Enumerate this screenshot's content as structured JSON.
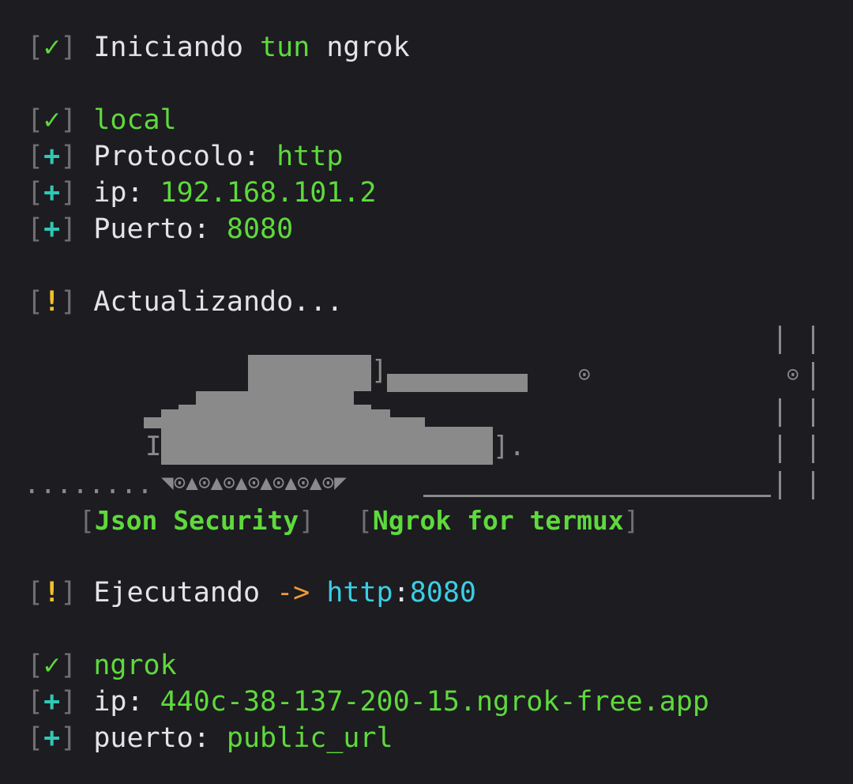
{
  "symbols": {
    "check": "✓",
    "plus": "+",
    "bang": "!",
    "open": "[",
    "close": "]"
  },
  "lines": {
    "iniciando": {
      "prefix": "Iniciando",
      "word": "tun",
      "rest": "ngrok"
    },
    "local": {
      "label": "local"
    },
    "protocolo": {
      "key": "Protocolo:",
      "value": "http"
    },
    "ip_local": {
      "key": "ip:",
      "value": "192.168.101.2"
    },
    "puerto_local": {
      "key": "Puerto:",
      "value": "8080"
    },
    "actualizando": {
      "text": "Actualizando..."
    },
    "ejecutando": {
      "text": "Ejecutando",
      "arrow": "->",
      "proto": "http",
      "colon": ":",
      "port": "8080"
    },
    "ngrok": {
      "label": "ngrok"
    },
    "ip_ngrok": {
      "key": "ip:",
      "value": "440c-38-137-200-15.ngrok-free.app"
    },
    "puerto_ngrok": {
      "key": "puerto:",
      "value": "public_url"
    }
  },
  "banner": {
    "left": "Json Security",
    "right": "Ngrok for termux"
  },
  "art": {
    "dots": "........",
    "bracket_right": "].",
    "bracket_top": "]",
    "letter": "I",
    "wheel": "⊙",
    "tread": "◥⊙▲⊙▲⊙▲⊙▲⊙▲⊙▲⊙◤",
    "wall": "|  |"
  },
  "colors": {
    "background": "#1c1c21",
    "green": "#5fd93c",
    "cyan_plus": "#2fc9b4",
    "yellow": "#f2c02a",
    "orange": "#f09a36",
    "cyan": "#3ccde3",
    "gray": "#8a8a8a"
  }
}
